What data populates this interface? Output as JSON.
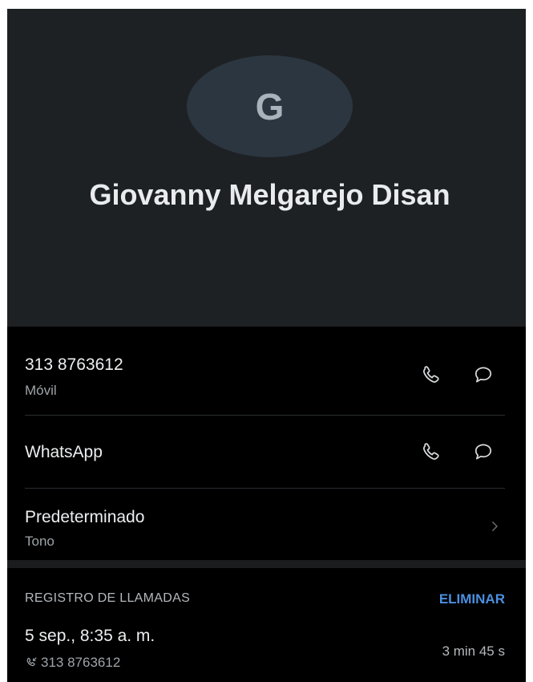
{
  "contact": {
    "avatar_letter": "G",
    "name": "Giovanny Melgarejo Disan"
  },
  "phone_row": {
    "number": "313 8763612",
    "type": "Móvil",
    "call_icon": "phone-icon",
    "message_icon": "message-bubble-icon"
  },
  "whatsapp_row": {
    "label": "WhatsApp",
    "call_icon": "phone-icon",
    "message_icon": "message-bubble-icon"
  },
  "ringtone_row": {
    "label": "Predeterminado",
    "sublabel": "Tono",
    "chevron_icon": "chevron-right-icon"
  },
  "call_log": {
    "title": "REGISTRO DE LLAMADAS",
    "delete_label": "ELIMINAR",
    "entries": [
      {
        "date": "5 sep., 8:35 a. m.",
        "number": "313 8763612",
        "duration": "3 min 45 s",
        "direction_icon": "incoming-call-icon"
      }
    ]
  },
  "colors": {
    "header_bg": "#1e2124",
    "avatar_bg": "#2b3640",
    "body_bg": "#000000",
    "accent": "#4c8fe0"
  }
}
